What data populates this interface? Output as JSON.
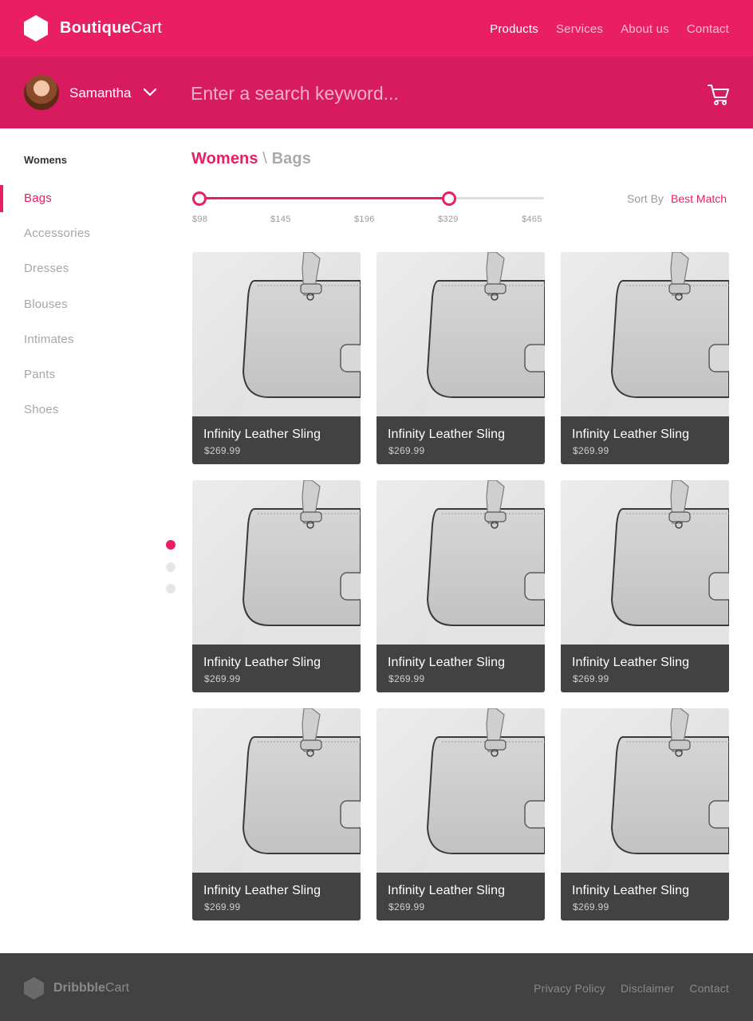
{
  "brand": {
    "bold": "Boutique",
    "light": "Cart"
  },
  "nav": [
    {
      "label": "Products",
      "active": true
    },
    {
      "label": "Services",
      "active": false
    },
    {
      "label": "About us",
      "active": false
    },
    {
      "label": "Contact",
      "active": false
    }
  ],
  "user": {
    "name": "Samantha"
  },
  "search": {
    "placeholder": "Enter a search keyword...",
    "value": ""
  },
  "sidebar": {
    "heading": "Womens",
    "items": [
      {
        "label": "Bags",
        "active": true
      },
      {
        "label": "Accessories"
      },
      {
        "label": "Dresses"
      },
      {
        "label": "Blouses"
      },
      {
        "label": "Intimates"
      },
      {
        "label": "Pants"
      },
      {
        "label": "Shoes"
      }
    ]
  },
  "breadcrumb": {
    "category": "Womens",
    "separator": "\\",
    "current": "Bags"
  },
  "price_filter": {
    "ticks": [
      "$98",
      "$145",
      "$196",
      "$329",
      "$465"
    ],
    "selected_min": "$98",
    "selected_max": "$329"
  },
  "sort": {
    "label": "Sort By",
    "value": "Best Match"
  },
  "pager": {
    "pages": 3,
    "current": 1
  },
  "products": [
    {
      "name": "Infinity Leather Sling",
      "price": "$269.99"
    },
    {
      "name": "Infinity Leather Sling",
      "price": "$269.99"
    },
    {
      "name": "Infinity Leather Sling",
      "price": "$269.99"
    },
    {
      "name": "Infinity Leather Sling",
      "price": "$269.99"
    },
    {
      "name": "Infinity Leather Sling",
      "price": "$269.99"
    },
    {
      "name": "Infinity Leather Sling",
      "price": "$269.99"
    },
    {
      "name": "Infinity Leather Sling",
      "price": "$269.99"
    },
    {
      "name": "Infinity Leather Sling",
      "price": "$269.99"
    },
    {
      "name": "Infinity Leather Sling",
      "price": "$269.99"
    }
  ],
  "footer": {
    "brand": {
      "bold": "Dribbble",
      "light": "Cart"
    },
    "links": [
      "Privacy Policy",
      "Disclaimer",
      "Contact"
    ]
  },
  "colors": {
    "accent": "#e91e63",
    "accent_dark": "#d81b5e",
    "dark": "#424242"
  },
  "icons": [
    "hexagon-logo-icon",
    "chevron-down-icon",
    "shopping-cart-icon"
  ]
}
